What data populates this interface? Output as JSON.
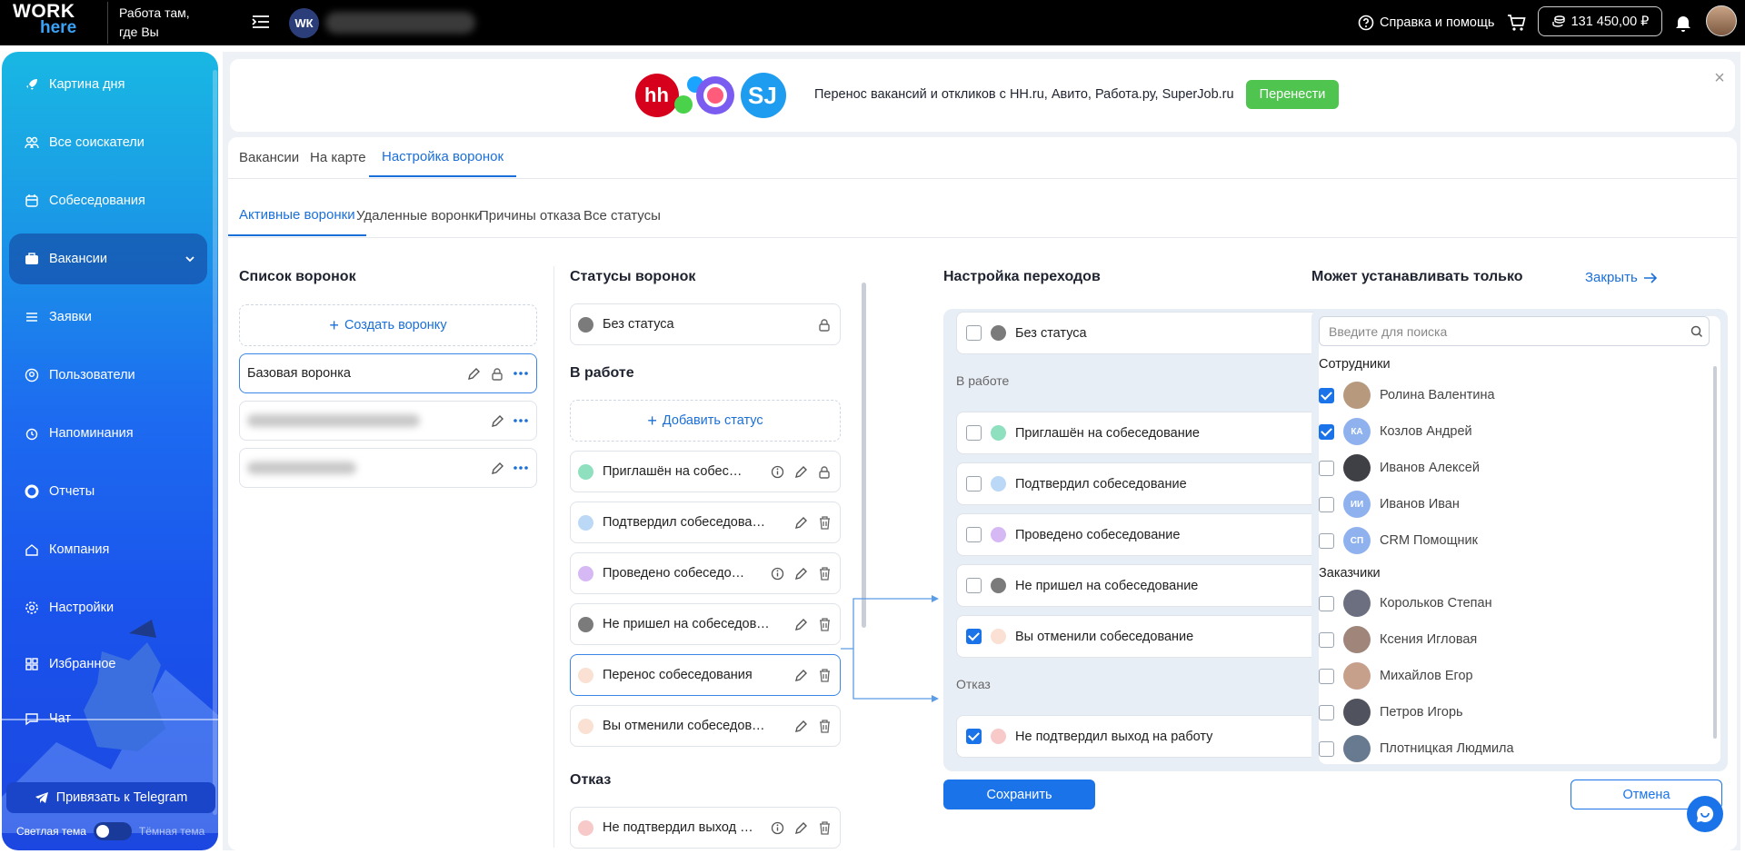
{
  "topbar": {
    "logo_line1": "WORK",
    "logo_line2": "here",
    "slogan_line1": "Работа там,",
    "slogan_line2": "где Вы",
    "wk_initials": "WК",
    "help_label": "Справка и помощь",
    "balance": "131 450,00 ₽"
  },
  "sidebar": {
    "items": [
      {
        "label": "Картина дня",
        "icon": "rocket-icon"
      },
      {
        "label": "Все соискатели",
        "icon": "users-icon"
      },
      {
        "label": "Собеседования",
        "icon": "calendar-icon"
      },
      {
        "label": "Вакансии",
        "icon": "briefcase-icon",
        "active": true
      },
      {
        "label": "Заявки",
        "icon": "list-icon"
      },
      {
        "label": "Пользователи",
        "icon": "user-circle-icon"
      },
      {
        "label": "Напоминания",
        "icon": "alarm-icon"
      },
      {
        "label": "Отчеты",
        "icon": "report-icon"
      },
      {
        "label": "Компания",
        "icon": "home-icon"
      },
      {
        "label": "Настройки",
        "icon": "gear-icon"
      },
      {
        "label": "Избранное",
        "icon": "grid-icon"
      },
      {
        "label": "Чат",
        "icon": "chat-icon"
      }
    ],
    "telegram_label": "Привязать к Telegram",
    "theme_light": "Светлая тема",
    "theme_dark": "Тёмная тема"
  },
  "banner": {
    "logo_text": "hh",
    "sj_text": "SJ",
    "text": "Перенос вакансий и откликов с HH.ru, Авито, Работа.ру, SuperJob.ru",
    "button": "Перенести"
  },
  "tabs": {
    "top": [
      "Вакансии",
      "На карте",
      "Настройка воронок"
    ],
    "sub": [
      "Активные воронки",
      "Удаленные воронки",
      "Причины отказа",
      "Все статусы"
    ]
  },
  "funnels": {
    "title": "Список воронок",
    "create_label": "Создать воронку",
    "items": [
      "Базовая воронка"
    ]
  },
  "statuses": {
    "title": "Статусы воронок",
    "no_status": "Без статуса",
    "in_work_title": "В работе",
    "add_label": "Добавить статус",
    "in_work": [
      {
        "label": "Приглашён на собеседование",
        "color": "#8fe0bf"
      },
      {
        "label": "Подтвердил собеседование",
        "color": "#bcd8f7"
      },
      {
        "label": "Проведено собеседование",
        "color": "#d6b8f5"
      },
      {
        "label": "Не пришел на собеседование",
        "color": "#7b7b7b"
      },
      {
        "label": "Перенос собеседования",
        "color": "#fbe0d4"
      },
      {
        "label": "Вы отменили собеседование",
        "color": "#fbe0d4"
      }
    ],
    "refusal_title": "Отказ",
    "refusal": [
      {
        "label": "Не подтвердил выход на работу",
        "color": "#f8c9c9"
      }
    ]
  },
  "transitions": {
    "title": "Настройка переходов",
    "no_status": "Без статуса",
    "in_work_label": "В работе",
    "in_work": [
      {
        "label": "Приглашён на собеседование",
        "color": "#8fe0bf",
        "checked": false
      },
      {
        "label": "Подтвердил собеседование",
        "color": "#bcd8f7",
        "checked": false
      },
      {
        "label": "Проведено собеседование",
        "color": "#d6b8f5",
        "checked": false
      },
      {
        "label": "Не пришел на собеседование",
        "color": "#7b7b7b",
        "checked": false
      },
      {
        "label": "Вы отменили собеседование",
        "color": "#fbe0d4",
        "checked": true
      }
    ],
    "refusal_label": "Отказ",
    "refusal": [
      {
        "label": "Не подтвердил выход на работу",
        "color": "#f8c9c9",
        "checked": true
      }
    ]
  },
  "who": {
    "title": "Может устанавливать только",
    "close_label": "Закрыть",
    "search_placeholder": "Введите для поиска",
    "employees_title": "Сотрудники",
    "employees": [
      {
        "name": "Ролина Валентина",
        "checked": true,
        "initials": ""
      },
      {
        "name": "Козлов Андрей",
        "checked": true,
        "initials": "КА"
      },
      {
        "name": "Иванов Алексей",
        "checked": false,
        "initials": ""
      },
      {
        "name": "Иванов Иван",
        "checked": false,
        "initials": "ИИ"
      },
      {
        "name": "CRM Помощник",
        "checked": false,
        "initials": "СП"
      }
    ],
    "customers_title": "Заказчики",
    "customers": [
      {
        "name": "Корольков Степан",
        "checked": false
      },
      {
        "name": "Ксения Игловая",
        "checked": false
      },
      {
        "name": "Михайлов Егор",
        "checked": false
      },
      {
        "name": "Петров Игорь",
        "checked": false
      },
      {
        "name": "Плотницкая Людмила",
        "checked": false
      }
    ]
  },
  "actions": {
    "save": "Сохранить",
    "cancel": "Отмена"
  }
}
